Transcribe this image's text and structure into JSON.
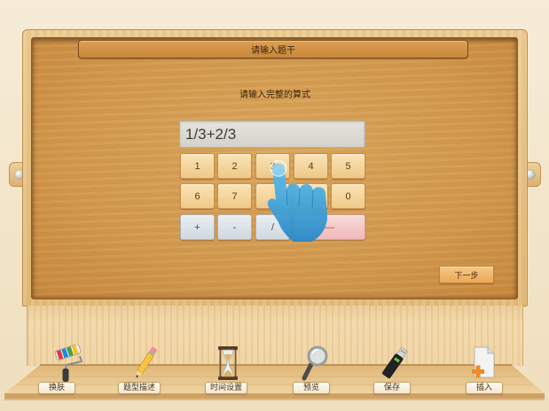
{
  "board": {
    "title": "请输入题干",
    "prompt": "请输入完整的算式",
    "expression_input": {
      "value": "1/3+2/3"
    },
    "keypad": {
      "rows": [
        [
          "1",
          "2",
          "3",
          "4",
          "5"
        ],
        [
          "6",
          "7",
          "0"
        ],
        [
          "+",
          "-",
          "/",
          "—"
        ]
      ]
    },
    "next_button_label": "下一步"
  },
  "toolbar": {
    "items": [
      {
        "label": "换肤",
        "icon": "paint-roller-icon"
      },
      {
        "label": "题型描述",
        "icon": "pencil-icon"
      },
      {
        "label": "时间设置",
        "icon": "hourglass-icon"
      },
      {
        "label": "预览",
        "icon": "magnifier-icon"
      },
      {
        "label": "保存",
        "icon": "usb-drive-icon"
      },
      {
        "label": "插入",
        "icon": "insert-document-icon"
      }
    ]
  },
  "colors": {
    "background": "#f3e6cb",
    "board_wood": "#d49a4e",
    "frame_wood": "#e6c083",
    "number_key": "#f2d29a",
    "operator_key": "#dbe2e7",
    "dash_key": "#f3c4c4",
    "pointer_hand": "#3aa0da",
    "next_button": "#eeb065"
  }
}
